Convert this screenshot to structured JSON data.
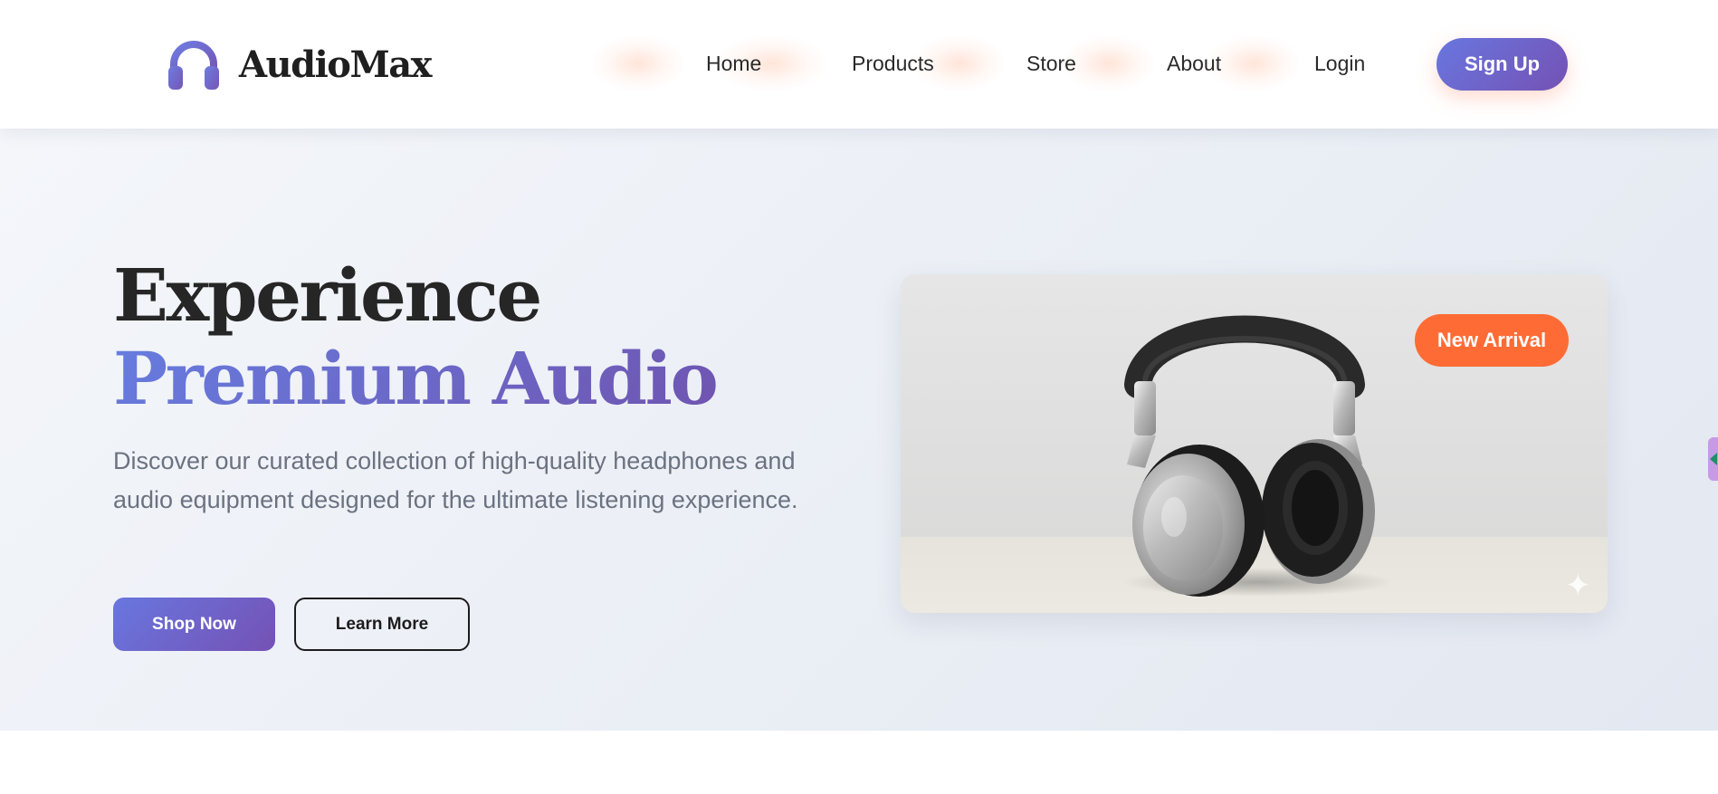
{
  "brand": {
    "name": "AudioMax",
    "icon": "headphones-icon",
    "icon_color": "#6f6ad8"
  },
  "nav": {
    "items": [
      {
        "label": "Home"
      },
      {
        "label": "Products"
      },
      {
        "label": "Store"
      },
      {
        "label": "About"
      },
      {
        "label": "Login"
      }
    ],
    "signup_label": "Sign Up"
  },
  "hero": {
    "title_plain": "Experience",
    "title_accent": "Premium Audio",
    "description": "Discover our curated collection of high-quality headphones and audio equipment designed for the ultimate listening experience.",
    "primary_button": "Shop Now",
    "secondary_button": "Learn More"
  },
  "product_card": {
    "image": "silver-black-headphones",
    "badge": "New Arrival",
    "sparkle_icon": "sparkle-icon"
  },
  "side_tab": {
    "icon": "chevron-left-icon"
  },
  "colors": {
    "accent_gradient_start": "#6877df",
    "accent_gradient_end": "#7551b4",
    "badge": "#ff6b35",
    "text_dark": "#262626",
    "text_muted": "#6b7280"
  }
}
